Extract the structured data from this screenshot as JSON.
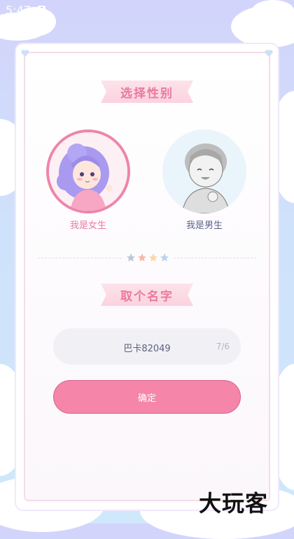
{
  "status_bar": {
    "time": "5:47",
    "notification_icon_letter": "A"
  },
  "gender_section": {
    "title": "选择性别",
    "options": [
      {
        "label": "我是女生",
        "selected": true
      },
      {
        "label": "我是男生",
        "selected": false
      }
    ]
  },
  "name_section": {
    "title": "取个名字",
    "input_value": "巴卡82049",
    "char_count": "7/6"
  },
  "confirm_button": {
    "label": "确定"
  },
  "watermark": "大玩客",
  "colors": {
    "accent_pink": "#f586aa",
    "selected_border": "#ee85ab",
    "title_text": "#e97aa0",
    "male_label": "#5c6490",
    "star_colors": [
      "#b9c8d8",
      "#f6b9a8",
      "#f8d9a4",
      "#b8d3ee"
    ]
  }
}
